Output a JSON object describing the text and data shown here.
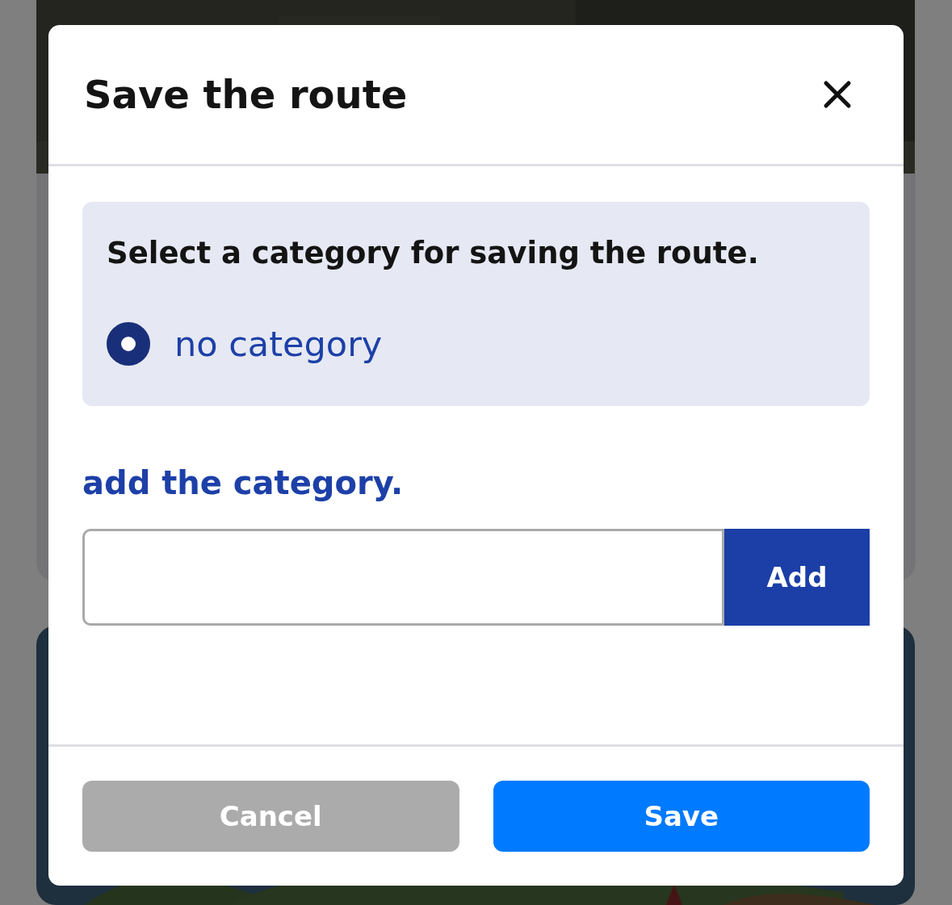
{
  "dialog": {
    "title": "Save the route",
    "prompt": "Select a category for saving the route.",
    "categories": [
      {
        "label": "no category",
        "selected": true
      }
    ],
    "add_heading": "add the category.",
    "add_button": "Add",
    "buttons": [
      {
        "kind": "cancel",
        "label": "Cancel"
      },
      {
        "kind": "primary",
        "label": "Save"
      }
    ]
  }
}
